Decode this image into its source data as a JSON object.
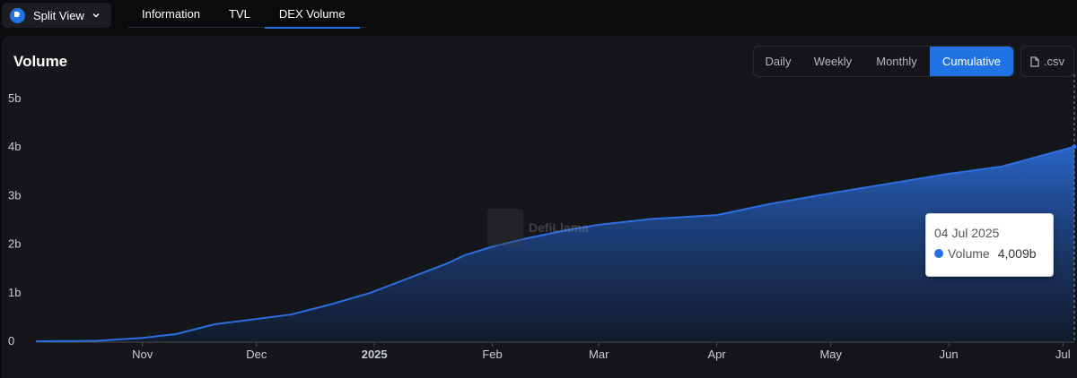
{
  "split_view": {
    "label": "Split View"
  },
  "tabs": [
    {
      "label": "Information",
      "active": false
    },
    {
      "label": "TVL",
      "active": false
    },
    {
      "label": "DEX Volume",
      "active": true
    }
  ],
  "panel": {
    "title": "Volume",
    "periods": [
      {
        "label": "Daily",
        "active": false
      },
      {
        "label": "Weekly",
        "active": false
      },
      {
        "label": "Monthly",
        "active": false
      },
      {
        "label": "Cumulative",
        "active": true
      }
    ],
    "csv_label": ".csv"
  },
  "watermark": {
    "text": "DefiLlama"
  },
  "tooltip": {
    "date": "04 Jul 2025",
    "series": "Volume",
    "value": "4,009b"
  },
  "colors": {
    "accent": "#2172e5",
    "line": "#2c6fe0",
    "background": "#151619"
  },
  "icons": {
    "logo": "defillama-logo-icon",
    "chevron": "chevron-down-icon",
    "file": "file-icon"
  },
  "chart_data": {
    "type": "area",
    "series": [
      {
        "name": "Volume",
        "x": [
          "2024-10-04",
          "2024-10-20",
          "2024-11-01",
          "2024-11-10",
          "2024-11-15",
          "2024-11-20",
          "2024-11-30",
          "2024-12-10",
          "2024-12-20",
          "2024-12-31",
          "2025-01-10",
          "2025-01-20",
          "2025-01-25",
          "2025-02-01",
          "2025-02-10",
          "2025-02-20",
          "2025-03-01",
          "2025-03-15",
          "2025-04-01",
          "2025-04-15",
          "2025-05-01",
          "2025-05-15",
          "2025-06-01",
          "2025-06-15",
          "2025-07-04"
        ],
        "values": [
          0.0,
          0.01,
          0.07,
          0.15,
          0.25,
          0.35,
          0.45,
          0.55,
          0.75,
          1.0,
          1.3,
          1.6,
          1.78,
          1.95,
          2.12,
          2.28,
          2.4,
          2.52,
          2.6,
          2.83,
          3.05,
          3.23,
          3.45,
          3.6,
          4.009
        ]
      }
    ],
    "y_ticks": [
      "0",
      "1b",
      "2b",
      "3b",
      "4b",
      "5b"
    ],
    "ylim": [
      0,
      5
    ],
    "x_ticks": [
      {
        "label": "Nov",
        "date": "2024-11-01",
        "bold": false
      },
      {
        "label": "Dec",
        "date": "2024-12-01",
        "bold": false
      },
      {
        "label": "2025",
        "date": "2025-01-01",
        "bold": true
      },
      {
        "label": "Feb",
        "date": "2025-02-01",
        "bold": false
      },
      {
        "label": "Mar",
        "date": "2025-03-01",
        "bold": false
      },
      {
        "label": "Apr",
        "date": "2025-04-01",
        "bold": false
      },
      {
        "label": "May",
        "date": "2025-05-01",
        "bold": false
      },
      {
        "label": "Jun",
        "date": "2025-06-01",
        "bold": false
      },
      {
        "label": "Jul",
        "date": "2025-07-01",
        "bold": false
      }
    ],
    "xlim": [
      "2024-10-04",
      "2025-07-04"
    ],
    "grid": false,
    "legend": "none"
  }
}
